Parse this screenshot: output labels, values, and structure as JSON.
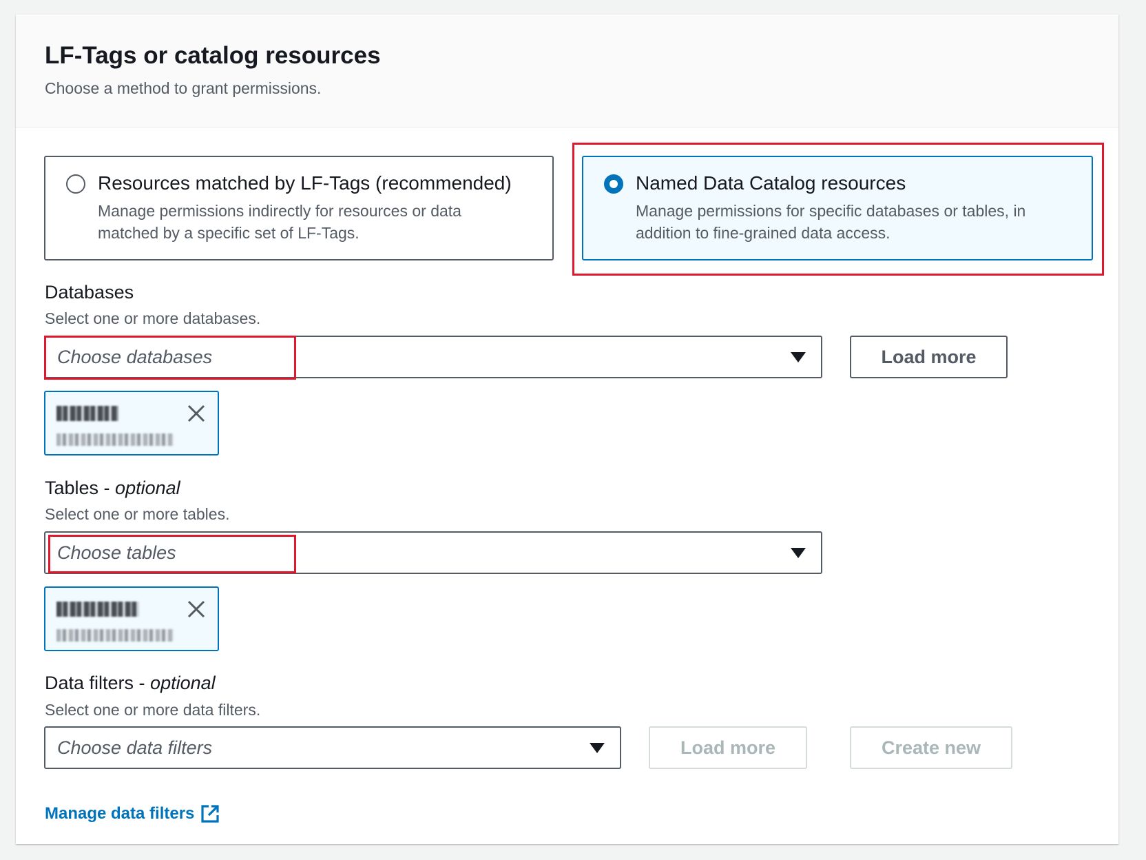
{
  "panel": {
    "title": "LF-Tags or catalog resources",
    "description": "Choose a method to grant permissions."
  },
  "methods": [
    {
      "title": "Resources matched by LF-Tags (recommended)",
      "description": "Manage permissions indirectly for resources or data matched by a specific set of LF-Tags.",
      "selected": false
    },
    {
      "title": "Named Data Catalog resources",
      "description": "Manage permissions for specific databases or tables, in addition to fine-grained data access.",
      "selected": true
    }
  ],
  "databases": {
    "label": "Databases",
    "description": "Select one or more databases.",
    "placeholder": "Choose databases",
    "load_more": "Load more"
  },
  "tables": {
    "label": "Tables - ",
    "label_optional": "optional",
    "description": "Select one or more tables.",
    "placeholder": "Choose tables"
  },
  "data_filters": {
    "label": "Data filters - ",
    "label_optional": "optional",
    "description": "Select one or more data filters.",
    "placeholder": "Choose data filters",
    "load_more": "Load more",
    "create_new": "Create new"
  },
  "manage_link": "Manage data filters",
  "colors": {
    "accent": "#0073bb",
    "highlight": "#e0182d",
    "disabled": "#aab7b8"
  }
}
